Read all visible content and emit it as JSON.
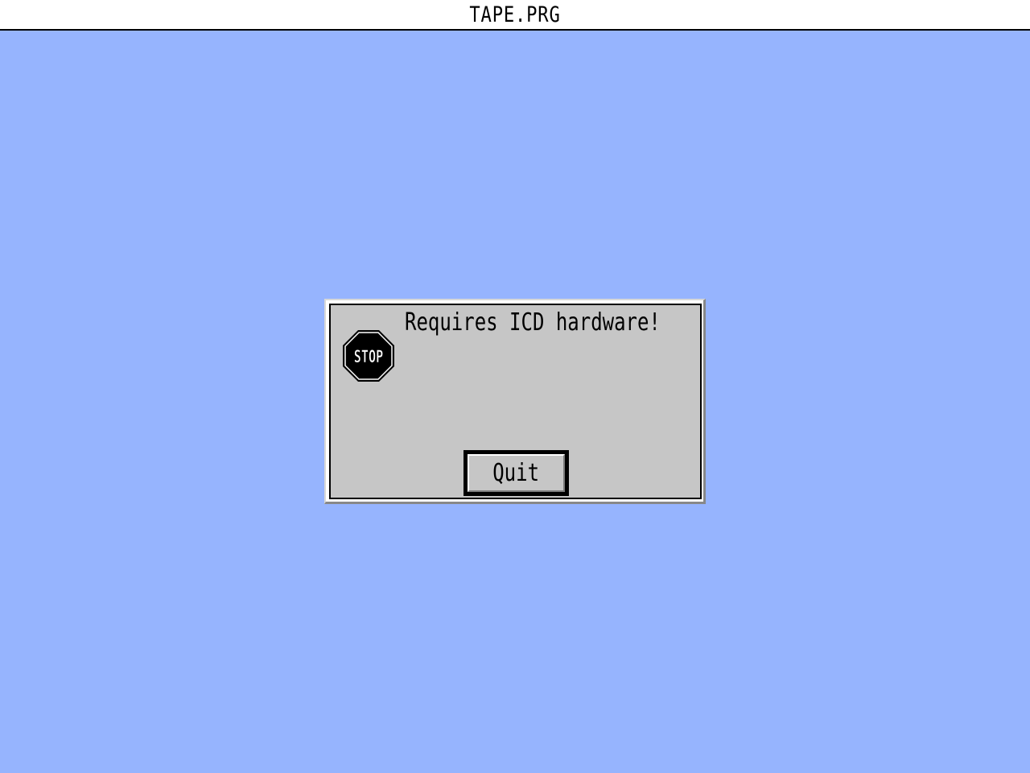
{
  "titlebar": {
    "title": "TAPE.PRG"
  },
  "alert": {
    "icon": "stop-icon",
    "icon_text": "STOP",
    "message": "Requires ICD hardware!",
    "button_label": "Quit"
  },
  "colors": {
    "desktop": "#96b4fe",
    "dialog": "#c6c6c6",
    "titlebar": "#ffffff",
    "text": "#000000"
  }
}
